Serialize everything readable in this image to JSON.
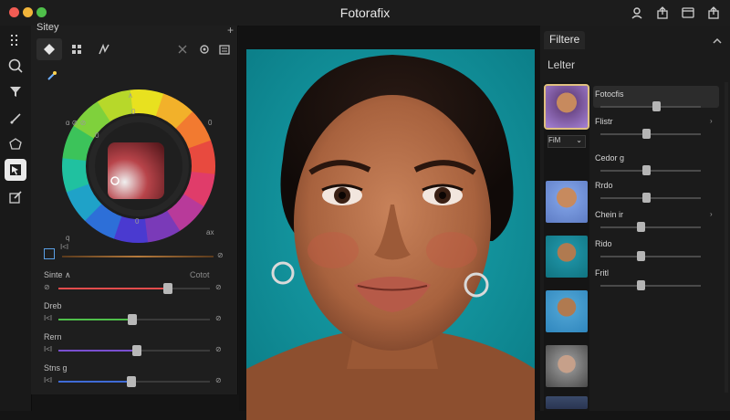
{
  "app": {
    "title": "Fotorafix"
  },
  "left_panel": {
    "tab_label": "Sitey",
    "plus": "+",
    "wheel_labels": {
      "top": "0",
      "left": "0",
      "bottom": "0",
      "br": "ax",
      "bl": "q",
      "tl": "ɑ ⊘ ⊘",
      "tr": "0",
      "lt": "∧"
    },
    "sliders": [
      {
        "label": "Sinte ∧",
        "right_caption": "Cotot",
        "value": 0.72,
        "color": "#e24c4c",
        "left_mini": "⊘",
        "right_mini": "⊘"
      },
      {
        "label": "Dreb",
        "value": 0.49,
        "color": "#4fbf4a",
        "left_mini": "I<I",
        "right_mini": "⊘"
      },
      {
        "label": "Rern",
        "value": 0.52,
        "color": "#7a4fd0",
        "left_mini": "I<I",
        "right_mini": "⊘"
      },
      {
        "label": "Stns g",
        "value": 0.48,
        "color": "#3f6bd6",
        "left_mini": "I<I",
        "right_mini": "⊘"
      }
    ],
    "picker_row": {
      "left_mini": "I<I",
      "right_mini": "⊘",
      "value": 0.0
    }
  },
  "right_panel": {
    "tab_label": "Filtere",
    "subtitle": "Lelter",
    "select_label": "FiM",
    "items": [
      {
        "name": "Fotocfis",
        "value": 0.55,
        "selected": true
      },
      {
        "name": "Flistr",
        "value": 0.45,
        "has_chevron": true
      },
      {
        "name": "Cedor g",
        "value": 0.45
      },
      {
        "name": "Rrdo",
        "value": 0.45
      },
      {
        "name": "Chein ir",
        "value": 0.4,
        "has_chevron": true
      },
      {
        "name": "Rido",
        "value": 0.4
      },
      {
        "name": "Fritl",
        "value": 0.4
      }
    ]
  },
  "colors": {
    "accent": "#5aa0e6",
    "panel": "#1e1e1e",
    "background": "#141414",
    "photo_bg": "#0f8e99"
  }
}
